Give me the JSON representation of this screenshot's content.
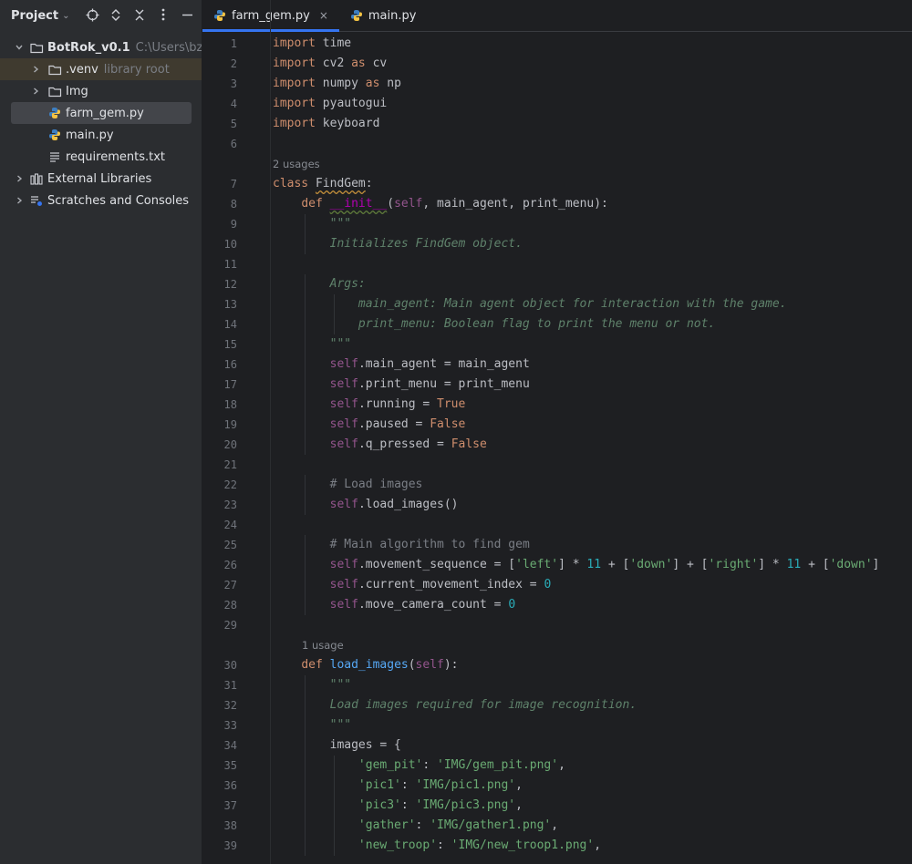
{
  "sidebar": {
    "title": "Project",
    "tree": [
      {
        "label": "BotRok_v0.1",
        "hint": "C:\\Users\\bzac",
        "icon": "folder-icon",
        "expanded": true,
        "level": 0
      },
      {
        "label": ".venv",
        "hint": "library root",
        "icon": "folder-icon",
        "expanded": false,
        "level": 1
      },
      {
        "label": "Img",
        "hint": "",
        "icon": "folder-icon",
        "expanded": false,
        "level": 1
      },
      {
        "label": "farm_gem.py",
        "hint": "",
        "icon": "python-file-icon",
        "level": 1,
        "selected": true
      },
      {
        "label": "main.py",
        "hint": "",
        "icon": "python-file-icon",
        "level": 1
      },
      {
        "label": "requirements.txt",
        "hint": "",
        "icon": "text-file-icon",
        "level": 1
      },
      {
        "label": "External Libraries",
        "hint": "",
        "icon": "library-icon",
        "level": 0
      },
      {
        "label": "Scratches and Consoles",
        "hint": "",
        "icon": "scratches-icon",
        "level": 0
      }
    ]
  },
  "tabs": [
    {
      "label": "farm_gem.py",
      "active": true,
      "close": "×"
    },
    {
      "label": "main.py",
      "active": false
    }
  ],
  "editor": {
    "usage_hints": {
      "class_usages": "2 usages",
      "method_usages": "1 usage"
    },
    "lines": [
      {
        "n": "1",
        "code": "import time"
      },
      {
        "n": "2",
        "code": "import cv2 as cv"
      },
      {
        "n": "3",
        "code": "import numpy as np"
      },
      {
        "n": "4",
        "code": "import pyautogui"
      },
      {
        "n": "5",
        "code": "import keyboard"
      },
      {
        "n": "6",
        "code": ""
      },
      {
        "n": "7",
        "code": "class FindGem:"
      },
      {
        "n": "8",
        "code": "    def __init__(self, main_agent, print_menu):"
      },
      {
        "n": "9",
        "code": "        \"\"\""
      },
      {
        "n": "10",
        "code": "        Initializes FindGem object."
      },
      {
        "n": "11",
        "code": ""
      },
      {
        "n": "12",
        "code": "        Args:"
      },
      {
        "n": "13",
        "code": "            main_agent: Main agent object for interaction with the game."
      },
      {
        "n": "14",
        "code": "            print_menu: Boolean flag to print the menu or not."
      },
      {
        "n": "15",
        "code": "        \"\"\""
      },
      {
        "n": "16",
        "code": "        self.main_agent = main_agent"
      },
      {
        "n": "17",
        "code": "        self.print_menu = print_menu"
      },
      {
        "n": "18",
        "code": "        self.running = True"
      },
      {
        "n": "19",
        "code": "        self.paused = False"
      },
      {
        "n": "20",
        "code": "        self.q_pressed = False"
      },
      {
        "n": "21",
        "code": ""
      },
      {
        "n": "22",
        "code": "        # Load images"
      },
      {
        "n": "23",
        "code": "        self.load_images()"
      },
      {
        "n": "24",
        "code": ""
      },
      {
        "n": "25",
        "code": "        # Main algorithm to find gem"
      },
      {
        "n": "26",
        "code": "        self.movement_sequence = ['left'] * 11 + ['down'] + ['right'] * 11 + ['down']"
      },
      {
        "n": "27",
        "code": "        self.current_movement_index = 0"
      },
      {
        "n": "28",
        "code": "        self.move_camera_count = 0"
      },
      {
        "n": "29",
        "code": ""
      },
      {
        "n": "30",
        "code": "    def load_images(self):"
      },
      {
        "n": "31",
        "code": "        \"\"\""
      },
      {
        "n": "32",
        "code": "        Load images required for image recognition."
      },
      {
        "n": "33",
        "code": "        \"\"\""
      },
      {
        "n": "34",
        "code": "        images = {"
      },
      {
        "n": "35",
        "code": "            'gem_pit': 'IMG/gem_pit.png',"
      },
      {
        "n": "36",
        "code": "            'pic1': 'IMG/pic1.png',"
      },
      {
        "n": "37",
        "code": "            'pic3': 'IMG/pic3.png',"
      },
      {
        "n": "38",
        "code": "            'gather': 'IMG/gather1.png',"
      },
      {
        "n": "39",
        "code": "            'new_troop': 'IMG/new_troop1.png',"
      }
    ]
  },
  "colors": {
    "keyword": "#cf8e6d",
    "function": "#56a8f5",
    "self": "#94558d",
    "docstring": "#5f826b",
    "string": "#6aab73",
    "number": "#2aacb8",
    "comment": "#7a7e85",
    "accent": "#3574f0"
  }
}
